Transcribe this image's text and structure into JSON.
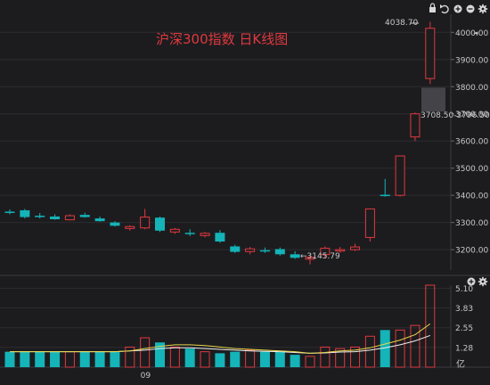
{
  "title": "沪深300指数 日K线图",
  "colors": {
    "background": "#1c1c1f",
    "up": "#e0393e",
    "down": "#14b4b8",
    "grid": "#2c2c30",
    "axis_text": "#c8c8c8",
    "title": "#e0393e",
    "ma_short": "#e8d64a",
    "ma_long": "#f0f0f0"
  },
  "toolbar_icons": [
    "lock-icon",
    "undo-icon",
    "zoom-in-icon",
    "zoom-out-icon",
    "settings-icon"
  ],
  "volume_toolbar_icons": [
    "zoom-in-icon",
    "settings-icon"
  ],
  "price_axis": {
    "labels": [
      "4000.00",
      "3900.00",
      "3800.00",
      "3700.00",
      "3600.00",
      "3500.00",
      "3400.00",
      "3300.00",
      "3200.00"
    ],
    "ylim": [
      3125,
      4060
    ]
  },
  "volume_axis": {
    "labels": [
      "5.10",
      "3.83",
      "2.55",
      "1.28"
    ],
    "unit": "亿",
    "ylim": [
      0,
      5.3
    ]
  },
  "x_axis": {
    "labels": [
      {
        "index": 9,
        "text": "09"
      }
    ]
  },
  "annotations": {
    "high": "4038.70",
    "low": "←3145.79",
    "crosshair_range": "3708.50-3796.50"
  },
  "chart_data": {
    "type": "candlestick",
    "title": "沪深300指数 日K线图",
    "candles": [
      {
        "o": 3340,
        "h": 3348,
        "l": 3330,
        "c": 3338,
        "dir": "down"
      },
      {
        "o": 3345,
        "h": 3350,
        "l": 3315,
        "c": 3320,
        "dir": "down"
      },
      {
        "o": 3325,
        "h": 3335,
        "l": 3315,
        "c": 3320,
        "dir": "down"
      },
      {
        "o": 3322,
        "h": 3330,
        "l": 3310,
        "c": 3312,
        "dir": "down"
      },
      {
        "o": 3310,
        "h": 3330,
        "l": 3308,
        "c": 3325,
        "dir": "up"
      },
      {
        "o": 3328,
        "h": 3336,
        "l": 3318,
        "c": 3320,
        "dir": "down"
      },
      {
        "o": 3315,
        "h": 3322,
        "l": 3303,
        "c": 3305,
        "dir": "down"
      },
      {
        "o": 3300,
        "h": 3305,
        "l": 3285,
        "c": 3288,
        "dir": "down"
      },
      {
        "o": 3278,
        "h": 3290,
        "l": 3270,
        "c": 3285,
        "dir": "up"
      },
      {
        "o": 3280,
        "h": 3350,
        "l": 3275,
        "c": 3320,
        "dir": "up"
      },
      {
        "o": 3318,
        "h": 3322,
        "l": 3265,
        "c": 3270,
        "dir": "down"
      },
      {
        "o": 3265,
        "h": 3280,
        "l": 3258,
        "c": 3275,
        "dir": "up"
      },
      {
        "o": 3262,
        "h": 3275,
        "l": 3250,
        "c": 3258,
        "dir": "down"
      },
      {
        "o": 3252,
        "h": 3265,
        "l": 3245,
        "c": 3260,
        "dir": "up"
      },
      {
        "o": 3262,
        "h": 3272,
        "l": 3225,
        "c": 3230,
        "dir": "down"
      },
      {
        "o": 3212,
        "h": 3218,
        "l": 3188,
        "c": 3192,
        "dir": "down"
      },
      {
        "o": 3193,
        "h": 3210,
        "l": 3183,
        "c": 3203,
        "dir": "up"
      },
      {
        "o": 3198,
        "h": 3208,
        "l": 3188,
        "c": 3197,
        "dir": "down"
      },
      {
        "o": 3202,
        "h": 3208,
        "l": 3178,
        "c": 3183,
        "dir": "down"
      },
      {
        "o": 3183,
        "h": 3194,
        "l": 3166,
        "c": 3170,
        "dir": "down"
      },
      {
        "o": 3165,
        "h": 3178,
        "l": 3146,
        "c": 3172,
        "dir": "up"
      },
      {
        "o": 3182,
        "h": 3212,
        "l": 3170,
        "c": 3205,
        "dir": "up"
      },
      {
        "o": 3195,
        "h": 3210,
        "l": 3188,
        "c": 3200,
        "dir": "up"
      },
      {
        "o": 3200,
        "h": 3222,
        "l": 3195,
        "c": 3210,
        "dir": "up"
      },
      {
        "o": 3245,
        "h": 3350,
        "l": 3230,
        "c": 3350,
        "dir": "up"
      },
      {
        "o": 3400,
        "h": 3460,
        "l": 3395,
        "c": 3402,
        "dir": "down"
      },
      {
        "o": 3400,
        "h": 3545,
        "l": 3395,
        "c": 3545,
        "dir": "up"
      },
      {
        "o": 3615,
        "h": 3705,
        "l": 3600,
        "c": 3700,
        "dir": "up"
      },
      {
        "o": 3830,
        "h": 4038.7,
        "l": 3810,
        "c": 4015,
        "dir": "up"
      }
    ],
    "volume": [
      1.0,
      1.0,
      1.0,
      1.0,
      1.0,
      1.0,
      1.0,
      1.0,
      1.3,
      1.9,
      1.6,
      1.3,
      1.2,
      1.0,
      0.9,
      1.0,
      1.1,
      1.0,
      1.0,
      0.8,
      0.7,
      1.3,
      1.2,
      1.3,
      2.0,
      2.4,
      2.4,
      2.7,
      5.3
    ],
    "volume_dir": [
      "down",
      "down",
      "down",
      "down",
      "up",
      "down",
      "down",
      "down",
      "up",
      "up",
      "down",
      "up",
      "down",
      "up",
      "down",
      "down",
      "up",
      "down",
      "down",
      "down",
      "up",
      "up",
      "up",
      "up",
      "up",
      "down",
      "up",
      "up",
      "up"
    ],
    "ma_short": [
      1.0,
      1.0,
      1.0,
      1.0,
      1.0,
      1.0,
      1.0,
      1.0,
      1.05,
      1.2,
      1.35,
      1.45,
      1.45,
      1.4,
      1.3,
      1.2,
      1.15,
      1.1,
      1.05,
      1.0,
      0.9,
      0.95,
      1.05,
      1.1,
      1.25,
      1.5,
      1.75,
      2.1,
      2.8
    ],
    "ma_long": [
      1.0,
      1.0,
      1.0,
      1.0,
      1.0,
      1.0,
      1.0,
      1.0,
      1.05,
      1.1,
      1.2,
      1.25,
      1.25,
      1.2,
      1.15,
      1.1,
      1.05,
      1.02,
      1.0,
      0.95,
      0.9,
      0.92,
      0.98,
      1.0,
      1.1,
      1.25,
      1.45,
      1.7,
      2.05
    ],
    "ylim": [
      3125,
      4060
    ]
  }
}
